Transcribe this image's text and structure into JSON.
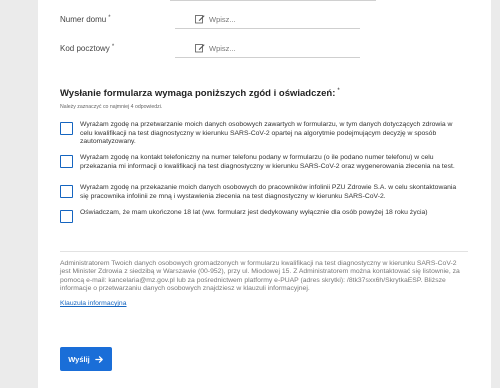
{
  "fields": [
    {
      "label": "Numer domu",
      "required_mark": "*",
      "placeholder": "Wpisz..."
    },
    {
      "label": "Kod pocztowy",
      "required_mark": "*",
      "placeholder": "Wpisz..."
    }
  ],
  "consents_section": {
    "title": "Wysłanie formularza wymaga poniższych zgód i oświadczeń:",
    "required_mark": "*",
    "hint": "Należy zaznaczyć co najmniej 4 odpowiedzi.",
    "items": [
      {
        "text": "Wyrażam zgodę na przetwarzanie moich danych osobowych zawartych w formularzu, w tym danych dotyczących zdrowia w celu kwalifikacji na test diagnostyczny w kierunku SARS-CoV-2 opartej na algorytmie podejmującym decyzję w sposób zautomatyzowany."
      },
      {
        "text": "Wyrażam zgodę na kontakt telefoniczny na numer telefonu podany w formularzu (o ile podano numer telefonu) w celu przekazania mi informacji o kwalifikacji na test diagnostyczny w kierunku SARS-CoV-2 oraz wygenerowania zlecenia na test."
      },
      {
        "text": "Wyrażam zgodę na przekazanie moich danych osobowych do pracowników infolinii PZU Zdrowie S.A. w celu skontaktowania się pracownika infolinii ze mną i wystawienia zlecenia na test diagnostyczny w kierunku SARS-CoV-2."
      },
      {
        "text": "Oświadczam, że mam ukończone 18 lat (ww. formularz jest dedykowany wyłącznie dla osób powyżej 18 roku życia)"
      }
    ]
  },
  "admin_note": "Administratorem Twoich danych osobowych gromadzonych w formularzu kwalifikacji na test diagnostyczny w kierunku SARS-CoV-2 jest Minister Zdrowia z siedzibą w Warszawie (00-952), przy ul. Miodowej 15. Z Administratorem można kontaktować się listownie, za pomocą e-mail: kancelaria@mz.gov.pl lub za pośrednictwem platformy e-PUAP (adres skrytki): /8tk37sxx6h/SkrytkaESP. Bliższe informacje o przetwarzaniu danych osobowych znajdziesz w klauzuli informacyjnej.",
  "clause_link": "Klauzula informacyjna",
  "submit_label": "Wyślij",
  "colors": {
    "accent": "#1a6ed8",
    "link": "#1565c0",
    "background": "#ebebeb"
  }
}
